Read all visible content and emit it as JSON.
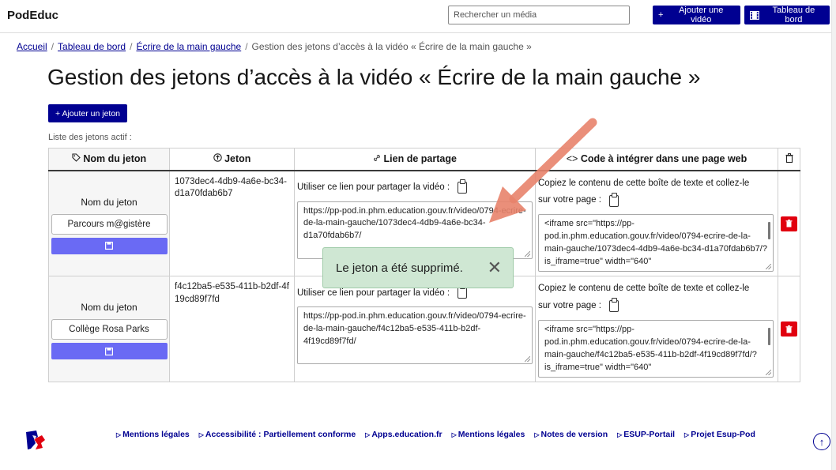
{
  "header": {
    "brand": "PodEduc",
    "search_placeholder": "Rechercher un média",
    "add_video_label": "Ajouter une vidéo",
    "dashboard_label": "Tableau de bord"
  },
  "breadcrumb": {
    "items": [
      "Accueil",
      "Tableau de bord",
      "Écrire de la main gauche"
    ],
    "current": "Gestion des jetons d’accès à la vidéo « Écrire de la main gauche »"
  },
  "page": {
    "title": "Gestion des jetons d’accès à la vidéo « Écrire de la main gauche »",
    "add_token_label": "+ Ajouter un jeton",
    "list_label": "Liste des jetons actif :"
  },
  "table": {
    "headers": {
      "name": "Nom du jeton",
      "token": "Jeton",
      "share": "Lien de partage",
      "embed": "Code à intégrer dans une page web"
    },
    "rows": [
      {
        "name_label": "Nom du jeton",
        "name_value": "Parcours m@gistère",
        "token": "1073dec4-4db9-4a6e-bc34-d1a70fdab6b7",
        "share_intro": "Utiliser ce lien pour partager la vidéo :",
        "share_link": "https://pp-pod.in.phm.education.gouv.fr/video/0794-ecrire-de-la-main-gauche/1073dec4-4db9-4a6e-bc34-d1a70fdab6b7/",
        "embed_intro": "Copiez le contenu de cette boîte de texte et collez-le",
        "embed_intro2": "sur votre page :",
        "embed_code": "<iframe src=\"https://pp-pod.in.phm.education.gouv.fr/video/0794-ecrire-de-la-main-gauche/1073dec4-4db9-4a6e-bc34-d1a70fdab6b7/?is_iframe=true\" width=\"640\""
      },
      {
        "name_label": "Nom du jeton",
        "name_value": "Collège Rosa Parks",
        "token": "f4c12ba5-e535-411b-b2df-4f19cd89f7fd",
        "share_intro": "Utiliser ce lien pour partager la vidéo :",
        "share_link": "https://pp-pod.in.phm.education.gouv.fr/video/0794-ecrire-de-la-main-gauche/f4c12ba5-e535-411b-b2df-4f19cd89f7fd/",
        "embed_intro": "Copiez le contenu de cette boîte de texte et collez-le",
        "embed_intro2": "sur votre page :",
        "embed_code": "<iframe src=\"https://pp-pod.in.phm.education.gouv.fr/video/0794-ecrire-de-la-main-gauche/f4c12ba5-e535-411b-b2df-4f19cd89f7fd/?is_iframe=true\" width=\"640\""
      }
    ]
  },
  "toast": {
    "message": "Le jeton a été supprimé."
  },
  "annotation": {
    "arrow_color": "#e8836c"
  },
  "footer": {
    "links": [
      "Mentions légales",
      "Accessibilité : Partiellement conforme",
      "Apps.education.fr",
      "Mentions légales",
      "Notes de version",
      "ESUP-Portail",
      "Projet Esup-Pod"
    ]
  },
  "colors": {
    "primary": "#000091",
    "save": "#6a6af4",
    "danger": "#e1000f",
    "toast_bg": "#cfe7d3"
  }
}
